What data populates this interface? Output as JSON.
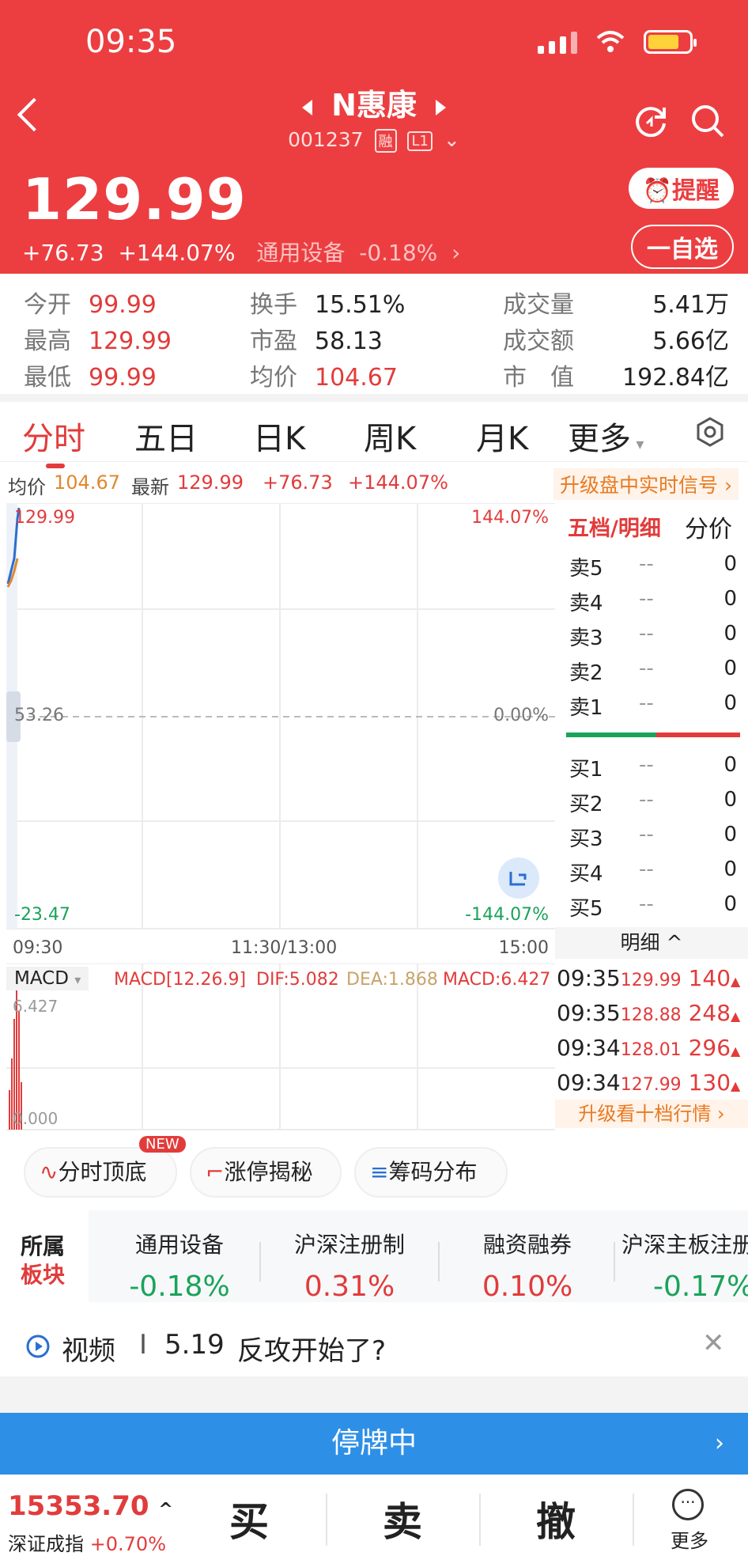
{
  "status": {
    "time": "09:35"
  },
  "header": {
    "stock_name": "N惠康",
    "code": "001237",
    "tag_rong": "融",
    "tag_level": "L1",
    "price": "129.99",
    "change": "+76.73",
    "change_pct": "+144.07%",
    "sector_name": "通用设备",
    "sector_pct": "-0.18%",
    "alert_label": "提醒",
    "watch_label": "一自选"
  },
  "quote": {
    "open_label": "今开",
    "open": "99.99",
    "high_label": "最高",
    "high": "129.99",
    "low_label": "最低",
    "low": "99.99",
    "turnover_label": "换手",
    "turnover": "15.51%",
    "pe_label": "市盈",
    "pe": "58.13",
    "avg_label": "均价",
    "avg": "104.67",
    "volume_label": "成交量",
    "volume": "5.41万",
    "amount_label": "成交额",
    "amount": "5.66亿",
    "mcap_label": "市　值",
    "mcap": "192.84亿"
  },
  "tabs": [
    "分时",
    "五日",
    "日K",
    "周K",
    "月K",
    "更多"
  ],
  "infobar": {
    "avg_label": "均价",
    "avg": "104.67",
    "latest_label": "最新",
    "latest": "129.99",
    "chg": "+76.73",
    "pct": "+144.07%",
    "upgrade": "升级盘中实时信号"
  },
  "chart": {
    "y_top": "129.99",
    "y_mid": "53.26",
    "y_bot": "-23.47",
    "pct_top": "144.07%",
    "pct_mid": "0.00%",
    "pct_bot": "-144.07%",
    "x_start": "09:30",
    "x_mid": "11:30/13:00",
    "x_end": "15:00"
  },
  "macd": {
    "label": "MACD",
    "params": "MACD[12.26.9]",
    "dif": "DIF:5.082",
    "dea": "DEA:1.868",
    "macd_val": "MACD:6.427",
    "y_top": "6.427",
    "y_bot": "0.000"
  },
  "orderbook": {
    "tab_active": "五档/明细",
    "tab_other": "分价",
    "sell": [
      "卖5",
      "卖4",
      "卖3",
      "卖2",
      "卖1"
    ],
    "buy": [
      "买1",
      "买2",
      "买3",
      "买4",
      "买5"
    ],
    "dash": "--",
    "zero": "0",
    "detail_label": "明细 ^",
    "ticks": [
      {
        "t": "09:35",
        "p": "129.99",
        "v": "140"
      },
      {
        "t": "09:35",
        "p": "128.88",
        "v": "248"
      },
      {
        "t": "09:34",
        "p": "128.01",
        "v": "296"
      },
      {
        "t": "09:34",
        "p": "127.99",
        "v": "130"
      }
    ],
    "upgrade": "升级看十档行情"
  },
  "chips": {
    "c1": "分时顶底",
    "c2": "涨停揭秘",
    "c3": "筹码分布",
    "new": "NEW"
  },
  "sectors": {
    "title1": "所属",
    "title2": "板块",
    "items": [
      {
        "name": "通用设备",
        "pct": "-0.18%"
      },
      {
        "name": "沪深注册制",
        "pct": "0.31%"
      },
      {
        "name": "融资融券",
        "pct": "0.10%"
      },
      {
        "name": "沪深主板注册",
        "pct": "-0.17%"
      }
    ]
  },
  "video": {
    "label": "视频",
    "sep": "I",
    "date": "5.19",
    "text": "反攻开始了?"
  },
  "halt": {
    "label": "停牌中"
  },
  "bottom": {
    "index_value": "15353.70",
    "index_name": "深证成指",
    "index_pct": "+0.70%",
    "buy": "买",
    "sell": "卖",
    "cancel": "撤",
    "more": "更多"
  },
  "colors": {
    "header_red": "#ec3e41",
    "up": "#e23b3b",
    "down": "#1aa35a",
    "halt_blue": "#2e8fe6"
  }
}
